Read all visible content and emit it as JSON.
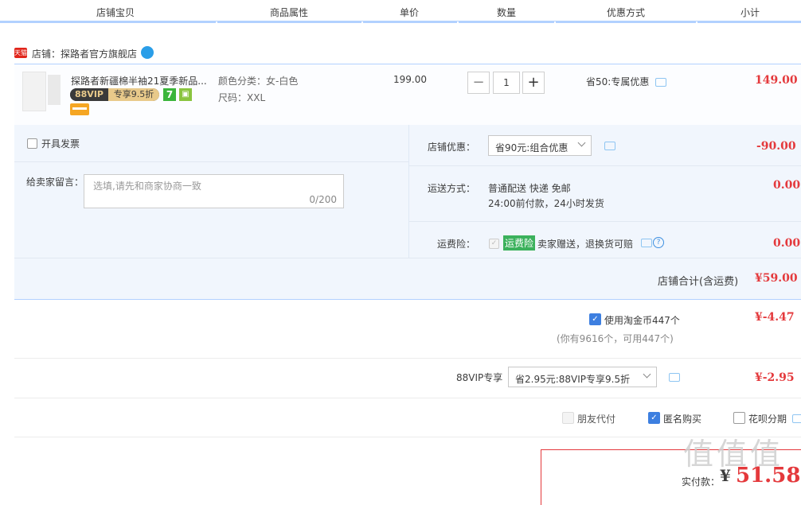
{
  "header": {
    "columns": [
      "店铺宝贝",
      "商品属性",
      "单价",
      "数量",
      "优惠方式",
      "小计"
    ]
  },
  "shop": {
    "badge": "天猫",
    "label": "店铺：",
    "name": "探路者官方旗舰店"
  },
  "item": {
    "title": "探路者新疆棉半袖21夏季新品...",
    "vip_left": "88VIP",
    "vip_right": "专享9.5折",
    "seven_badge": "7",
    "color_label": "颜色分类：女-白色",
    "size_label": "尺码：XXL",
    "unit_price": "199.00",
    "quantity": "1",
    "qty_minus": "−",
    "qty_plus": "+",
    "discount": "省50:专属优惠",
    "subtotal": "149.00"
  },
  "options": {
    "invoice_label": "开具发票",
    "message_label": "给卖家留言：",
    "message_placeholder": "选填,请先和商家协商一致",
    "message_count": "0/200",
    "shop_discount_label": "店铺优惠：",
    "shop_discount_select": "省90元:组合优惠",
    "shop_discount_amount": "-90.00",
    "shipping_label": "运送方式：",
    "shipping_line1": "普通配送 快递 免邮",
    "shipping_line2": "24:00前付款，24小时发货",
    "shipping_amount": "0.00",
    "insurance_label": "运费险：",
    "insurance_tag": "运费险",
    "insurance_text": "卖家赠送，退换货可赔",
    "insurance_amount": "0.00",
    "shop_total_label": "店铺合计(含运费)",
    "shop_total": "¥59.00"
  },
  "coins": {
    "label": "使用淘金币447个",
    "note": "(你有9616个，可用447个)",
    "amount": "¥-4.47"
  },
  "vip_row": {
    "label": "88VIP专享",
    "select": "省2.95元:88VIP专享9.5折",
    "amount": "¥-2.95"
  },
  "extra": {
    "friend_pay": "朋友代付",
    "anonymous": "匿名购买",
    "huabei": "花呗分期"
  },
  "pay": {
    "label": "实付款：",
    "currency": "¥",
    "amount": "51.58"
  },
  "watermark": "值值值",
  "colors": {
    "accent_red": "#e4393c",
    "header_border": "#b2d1ff",
    "panel_bg": "#f1f6fd",
    "checkbox_blue": "#3d7fe0"
  }
}
